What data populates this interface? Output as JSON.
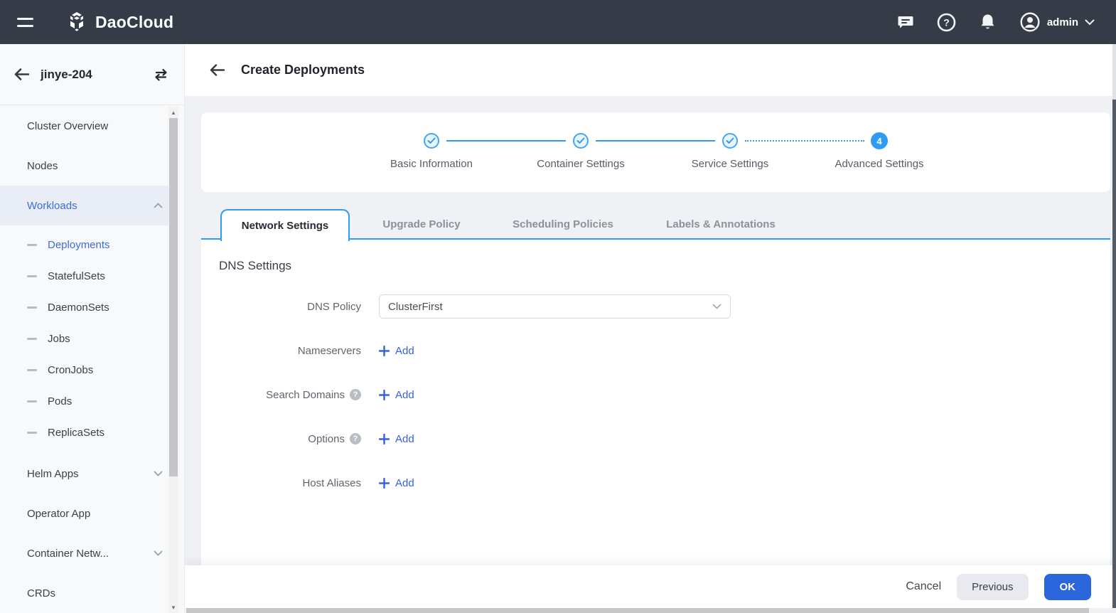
{
  "topbar": {
    "brand": "DaoCloud",
    "user": "admin"
  },
  "sidebar": {
    "title": "jinye-204",
    "items": [
      {
        "label": "Cluster Overview"
      },
      {
        "label": "Nodes"
      },
      {
        "label": "Workloads"
      },
      {
        "label": "Deployments"
      },
      {
        "label": "StatefulSets"
      },
      {
        "label": "DaemonSets"
      },
      {
        "label": "Jobs"
      },
      {
        "label": "CronJobs"
      },
      {
        "label": "Pods"
      },
      {
        "label": "ReplicaSets"
      },
      {
        "label": "Helm Apps"
      },
      {
        "label": "Operator App"
      },
      {
        "label": "Container Netw..."
      },
      {
        "label": "CRDs"
      }
    ]
  },
  "page": {
    "title": "Create Deployments"
  },
  "stepper": {
    "steps": [
      {
        "label": "Basic Information",
        "state": "done"
      },
      {
        "label": "Container Settings",
        "state": "done"
      },
      {
        "label": "Service Settings",
        "state": "done"
      },
      {
        "label": "Advanced Settings",
        "state": "current",
        "number": "4"
      }
    ]
  },
  "tabs": [
    {
      "label": "Network Settings",
      "active": true
    },
    {
      "label": "Upgrade Policy",
      "active": false
    },
    {
      "label": "Scheduling Policies",
      "active": false
    },
    {
      "label": "Labels & Annotations",
      "active": false
    }
  ],
  "form": {
    "section_title": "DNS Settings",
    "rows": [
      {
        "label": "DNS Policy",
        "control": "select",
        "value": "ClusterFirst"
      },
      {
        "label": "Nameservers",
        "control": "add",
        "add_label": "Add"
      },
      {
        "label": "Search Domains",
        "control": "add",
        "help": true,
        "add_label": "Add"
      },
      {
        "label": "Options",
        "control": "add",
        "help": true,
        "add_label": "Add"
      },
      {
        "label": "Host Aliases",
        "control": "add",
        "add_label": "Add"
      }
    ]
  },
  "footer": {
    "cancel": "Cancel",
    "previous": "Previous",
    "ok": "OK"
  },
  "colors": {
    "topbar": "#353b47",
    "accent_blue": "#2e9cf4",
    "link_blue": "#3561de",
    "ok_blue": "#2b66dd",
    "active_menu_blue": "#3c6be0"
  }
}
